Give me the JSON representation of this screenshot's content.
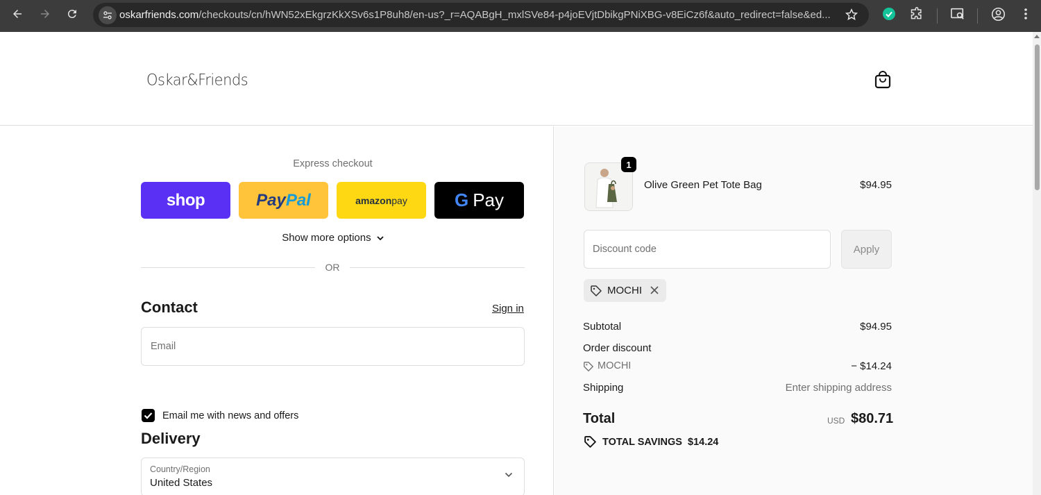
{
  "browser": {
    "url_domain": "oskarfriends.com",
    "url_path": "/checkouts/cn/hWN52xEkgrzKkXSv6s1P8uh8/en-us?_r=AQABgH_mxlSVe84-p4joEVjtDbikgPNiXBG-v8EiCz6f&auto_redirect=false&ed..."
  },
  "store": {
    "logo_text": "Oskar&Friends"
  },
  "express": {
    "label": "Express checkout",
    "shop_label": "shop",
    "paypal_part1": "Pay",
    "paypal_part2": "Pal",
    "amazon_part1": "amazon",
    "amazon_part2": " pay",
    "gpay_g": "G",
    "gpay_label": "Pay",
    "more_options": "Show more options",
    "or_label": "OR"
  },
  "contact": {
    "heading": "Contact",
    "sign_in": "Sign in",
    "email_placeholder": "Email",
    "news_label": "Email me with news and offers"
  },
  "delivery": {
    "heading": "Delivery",
    "country_label": "Country/Region",
    "country_value": "United States"
  },
  "summary": {
    "item": {
      "name": "Olive Green Pet Tote Bag",
      "quantity": "1",
      "price": "$94.95"
    },
    "discount_placeholder": "Discount code",
    "apply_label": "Apply",
    "applied_code": "MOCHI",
    "subtotal_label": "Subtotal",
    "subtotal_value": "$94.95",
    "order_discount_label": "Order discount",
    "discount_code": "MOCHI",
    "discount_value": "− $14.24",
    "shipping_label": "Shipping",
    "shipping_value": "Enter shipping address",
    "total_label": "Total",
    "total_currency": "USD",
    "total_value": "$80.71",
    "savings_label": "TOTAL SAVINGS",
    "savings_value": "$14.24"
  },
  "colors": {
    "shop_pay": "#5a31f4",
    "paypal": "#ffc439",
    "amazon_pay": "#ffd814",
    "google_pay": "#000000"
  }
}
